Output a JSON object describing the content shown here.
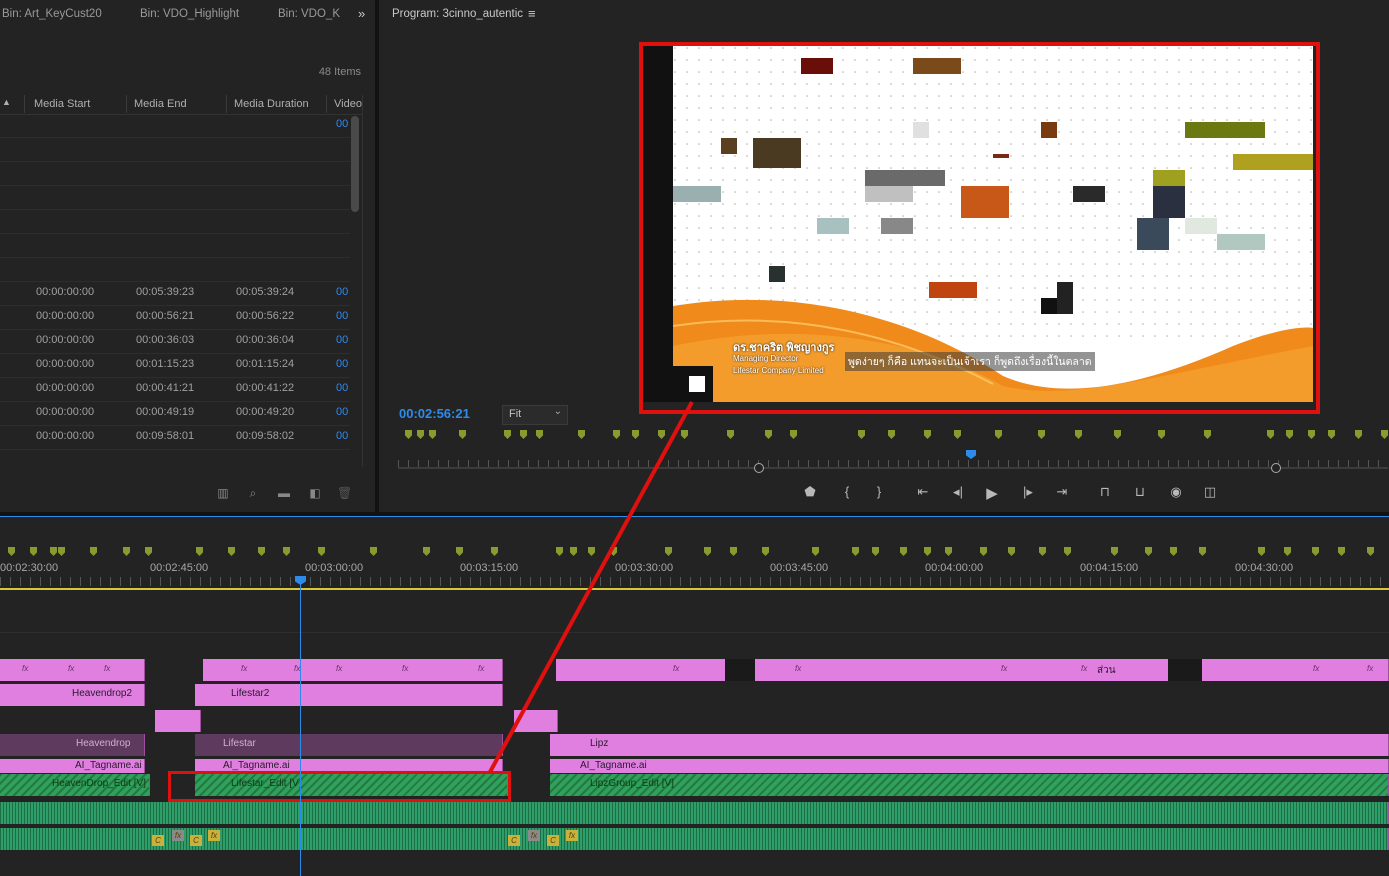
{
  "project_panel": {
    "tabs": [
      "Bin: Art_KeyCust20",
      "Bin: VDO_Highlight",
      "Bin: VDO_K"
    ],
    "overflow_icon": "double-chevron-right-icon",
    "items_count": "48 Items",
    "sort_icon": "caret-up-icon",
    "columns": [
      "Media Start",
      "Media End",
      "Media Duration",
      "Video"
    ],
    "first_row_video": "00",
    "rows": [
      {
        "start": "00:00:00:00",
        "end": "00:05:39:23",
        "duration": "00:05:39:24",
        "video": "00"
      },
      {
        "start": "00:00:00:00",
        "end": "00:00:56:21",
        "duration": "00:00:56:22",
        "video": "00"
      },
      {
        "start": "00:00:00:00",
        "end": "00:00:36:03",
        "duration": "00:00:36:04",
        "video": "00"
      },
      {
        "start": "00:00:00:00",
        "end": "00:01:15:23",
        "duration": "00:01:15:24",
        "video": "00"
      },
      {
        "start": "00:00:00:00",
        "end": "00:00:41:21",
        "duration": "00:00:41:22",
        "video": "00"
      },
      {
        "start": "00:00:00:00",
        "end": "00:00:49:19",
        "duration": "00:00:49:20",
        "video": "00"
      },
      {
        "start": "00:00:00:00",
        "end": "00:09:58:01",
        "duration": "00:09:58:02",
        "video": "00"
      }
    ],
    "bottom_icons": [
      "freeform-view-icon",
      "search-icon",
      "new-bin-icon",
      "new-item-icon",
      "trash-icon"
    ]
  },
  "program_monitor": {
    "title": "Program: 3cinno_autentic",
    "menu_icon": "hamburger-menu-icon",
    "timecode": "00:02:56:21",
    "fit_label": "Fit",
    "video_overlay": {
      "name": "ดร.ชาคริต พิชญางกูร",
      "role": "Managing Director",
      "company": "Lifestar Company Limited",
      "subtitle": "พูดง่ายๆ ก็คือ แทนจะเป็นเจ้าเรา ก็พูดถึงเรื่องนี้ในตลาด"
    },
    "controls": [
      "add-marker-icon",
      "mark-in-icon",
      "mark-out-icon",
      "go-to-in-icon",
      "step-back-icon",
      "play-icon",
      "step-forward-icon",
      "go-to-out-icon",
      "lift-icon",
      "extract-icon",
      "export-frame-icon",
      "comparison-view-icon"
    ]
  },
  "timeline": {
    "timecodes": [
      "00:02:30:00",
      "00:02:45:00",
      "00:03:00:00",
      "00:03:15:00",
      "00:03:30:00",
      "00:03:45:00",
      "00:04:00:00",
      "00:04:15:00",
      "00:04:30:00"
    ],
    "clips": {
      "heavendrop2": "Heavendrop2",
      "lifestar2": "Lifestar2",
      "heavendrop": "Heavendrop",
      "lifestar": "Lifestar",
      "lipz": "Lipz",
      "ai_tag1": "AI_Tagname.ai",
      "ai_tag2": "AI_Tagname.ai",
      "ai_tag3": "AI_Tagname.ai",
      "heavendrop_edit": "HeavenDrop_Edit [V]",
      "lifestar_edit": "Lifestar_Edit [V]",
      "lipzgroup_edit": "LipzGroup_Edit [V]",
      "thai_clip": "ส่วน"
    },
    "colors": {
      "clip": "#e07fe0",
      "dark_clip": "#5e3b5e",
      "green": "#2fa15a",
      "marker": "#8a9a2e",
      "playhead": "#2d8ceb",
      "highlight": "#e0100f"
    }
  }
}
